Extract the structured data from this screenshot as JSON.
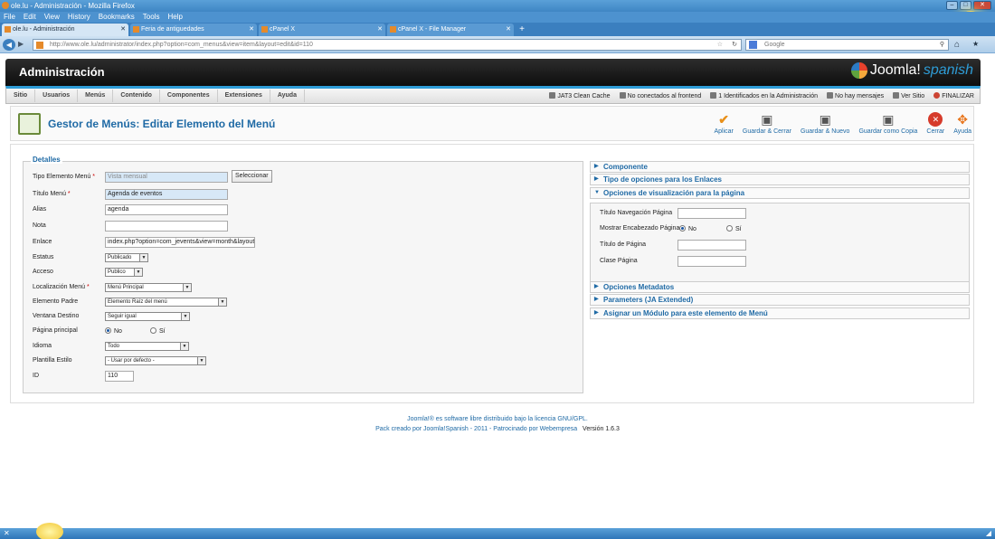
{
  "browser": {
    "title": "ole.lu - Administración - Mozilla Firefox",
    "menu": [
      "File",
      "Edit",
      "View",
      "History",
      "Bookmarks",
      "Tools",
      "Help"
    ],
    "tabs": [
      {
        "label": "ole.lu - Administración"
      },
      {
        "label": "Feria de antiguedades"
      },
      {
        "label": "cPanel X"
      },
      {
        "label": "cPanel X - File Manager"
      }
    ],
    "url": "http://www.ole.lu/administrator/index.php?option=com_menus&view=item&layout=edit&id=110",
    "search_placeholder": "Google"
  },
  "admin": {
    "title": "Administración",
    "logo_word": "Joomla!",
    "logo_suffix": "spanish"
  },
  "submenu": {
    "items": [
      "Sitio",
      "Usuarios",
      "Menús",
      "Contenido",
      "Componentes",
      "Extensiones",
      "Ayuda"
    ],
    "status": [
      "JAT3 Clean Cache",
      "No conectados al frontend",
      "1 Identificados en la Administración",
      "No hay mensajes",
      "Ver Sitio",
      "FINALIZAR"
    ]
  },
  "toolbar": {
    "title": "Gestor de Menús: Editar Elemento del Menú",
    "buttons": [
      "Aplicar",
      "Guardar & Cerrar",
      "Guardar & Nuevo",
      "Guardar como Copia",
      "Cerrar",
      "Ayuda"
    ]
  },
  "details": {
    "legend": "Detalles",
    "tipo_label": "Tipo Elemento Menú",
    "tipo_value": "Vista mensual",
    "select_button": "Seleccionar",
    "titulo_label": "Título Menú",
    "titulo_value": "Agenda de eventos",
    "alias_label": "Alias",
    "alias_value": "agenda",
    "nota_label": "Nota",
    "nota_value": "",
    "enlace_label": "Enlace",
    "enlace_value": "index.php?option=com_jevents&view=month&layout=",
    "estatus_label": "Estatus",
    "estatus_value": "Publicado",
    "acceso_label": "Acceso",
    "acceso_value": "Publico",
    "localizacion_label": "Localización Menú",
    "localizacion_value": "Menú Principal",
    "padre_label": "Elemento Padre",
    "padre_value": "Elemento Raíz del menú",
    "ventana_label": "Ventana Destino",
    "ventana_value": "Seguir igual",
    "principal_label": "Página principal",
    "principal_no": "No",
    "principal_si": "Sí",
    "idioma_label": "Idioma",
    "idioma_value": "Todo",
    "plantilla_label": "Plantilla Estilo",
    "plantilla_value": "- Usar por defecto -",
    "id_label": "ID",
    "id_value": "110"
  },
  "right": {
    "componente": "Componente",
    "tipo_enlaces": "Tipo de opciones para los Enlaces",
    "opciones_vis": "Opciones de visualización para la página",
    "nav_label": "Título Navegación Página",
    "encabezado_label": "Mostrar Encabezado Página",
    "encabezado_no": "No",
    "encabezado_si": "Sí",
    "titulo_pag_label": "Título de Página",
    "clase_label": "Clase Página",
    "metadatos": "Opciones Metadatos",
    "parameters": "Parameters (JA Extended)",
    "modulo": "Asignar un Módulo para este elemento de Menú"
  },
  "footer": {
    "line1": "Joomla!® es software libre distribuido bajo la licencia GNU/GPL.",
    "line2": "Pack creado por Joomla!Spanish - 2011 - Patrocinado por Webempresa",
    "version": "Versión 1.6.3"
  }
}
